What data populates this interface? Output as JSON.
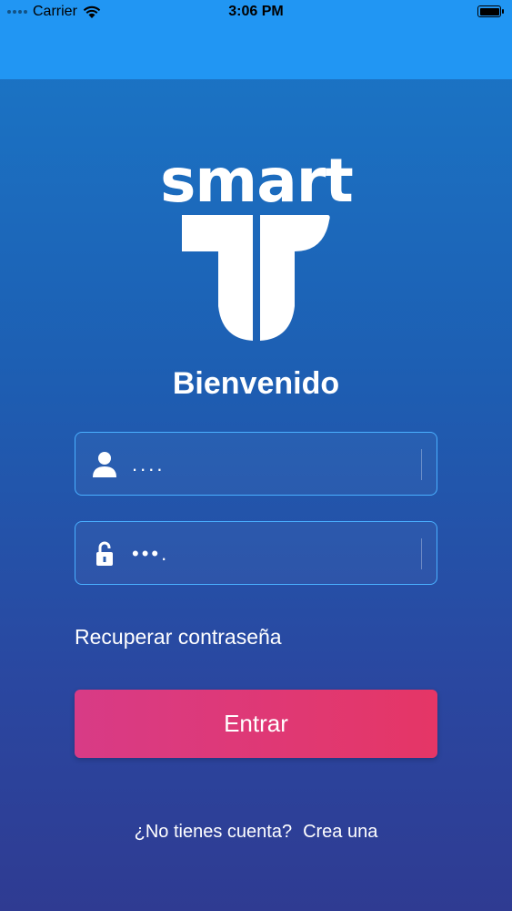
{
  "status_bar": {
    "carrier": "Carrier",
    "time": "3:06 PM"
  },
  "logo": {
    "wordmark": "smart"
  },
  "login": {
    "title": "Bienvenido",
    "username_value": "....",
    "password_value": "•••.",
    "forgot_password": "Recuperar contraseña",
    "submit_label": "Entrar"
  },
  "signup": {
    "prompt": "¿No tienes cuenta?",
    "link": "Crea una"
  },
  "colors": {
    "top_bar": "#2196f3",
    "field_border": "#4ab0ff",
    "button_start": "#d83b86",
    "button_end": "#e53666"
  }
}
